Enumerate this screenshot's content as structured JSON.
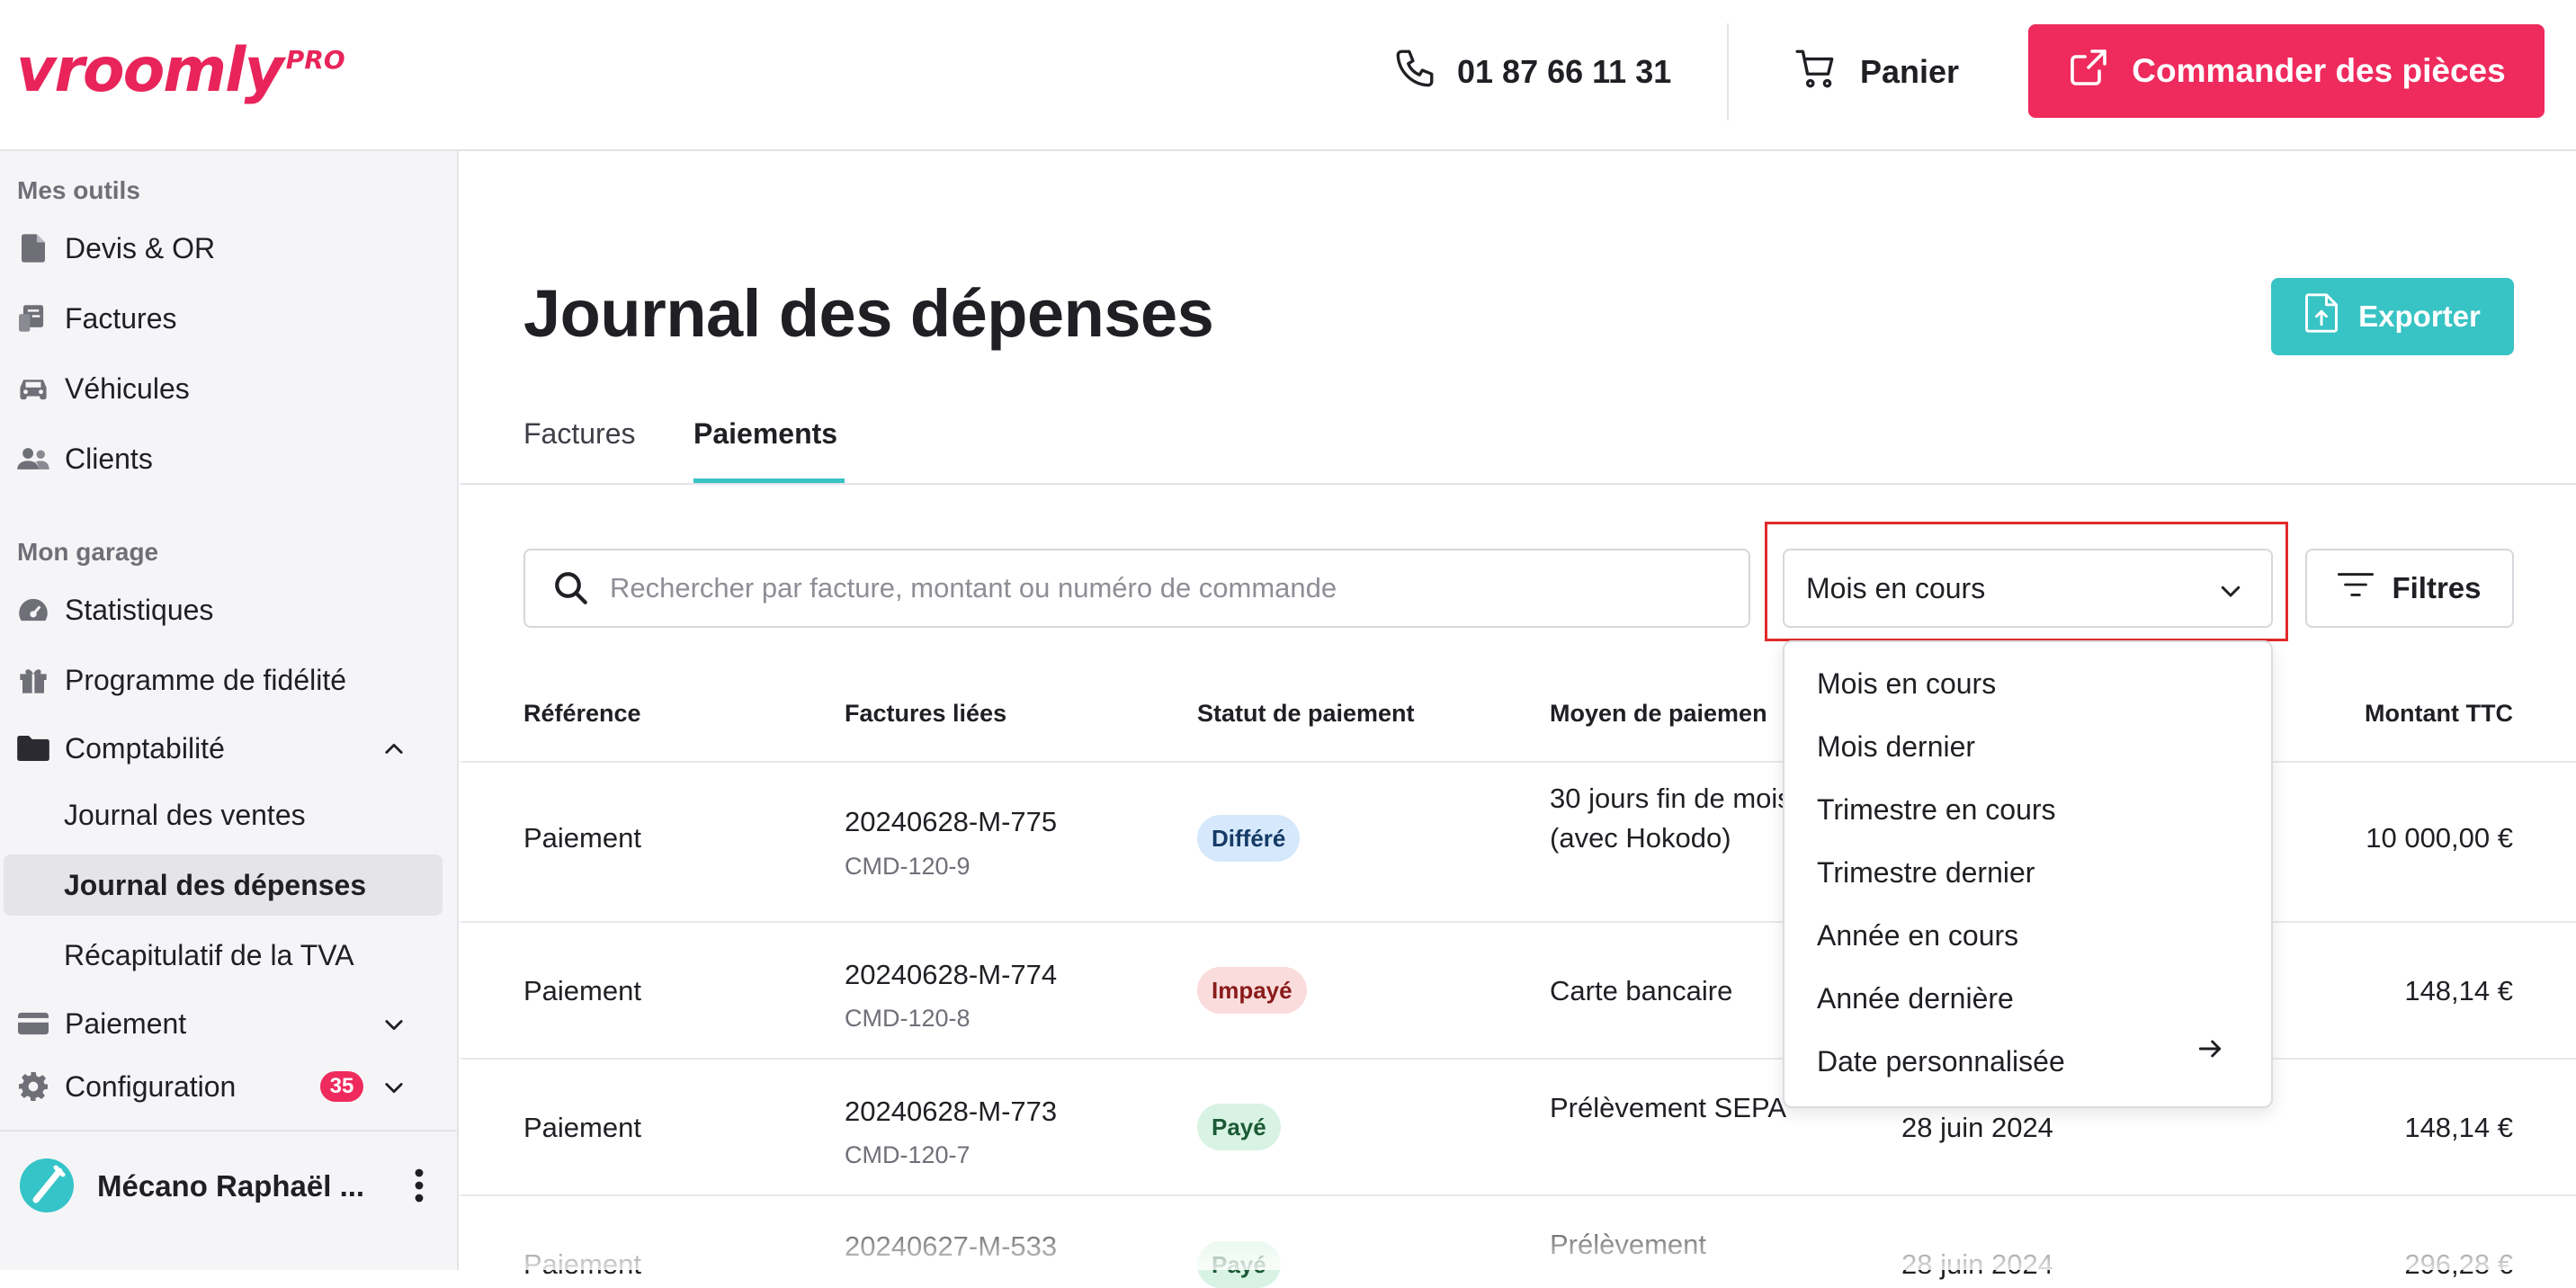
{
  "brand": {
    "logo_text": "vroomly",
    "logo_suffix": "PRO",
    "color": "#e8245a"
  },
  "header": {
    "phone": "01 87 66 11 31",
    "cart_label": "Panier",
    "order_button": "Commander des pièces"
  },
  "sidebar": {
    "section_tools": "Mes outils",
    "tools": [
      "Devis & OR",
      "Factures",
      "Véhicules",
      "Clients"
    ],
    "section_garage": "Mon garage",
    "garage": [
      "Statistiques",
      "Programme de fidélité"
    ],
    "accounting": {
      "label": "Comptabilité",
      "children": [
        "Journal des ventes",
        "Journal des dépenses",
        "Récapitulatif de la TVA"
      ],
      "active": "Journal des dépenses"
    },
    "payment": "Paiement",
    "configuration": "Configuration",
    "configuration_badge": "35",
    "user_name": "Mécano Raphaël ..."
  },
  "main": {
    "title": "Journal des dépenses",
    "export_button": "Exporter",
    "tabs": [
      "Factures",
      "Paiements"
    ],
    "active_tab": "Paiements",
    "search_placeholder": "Rechercher par facture, montant ou numéro de commande",
    "period_select": "Mois en cours",
    "filters_button": "Filtres"
  },
  "table": {
    "headers": {
      "reference": "Référence",
      "invoices": "Factures liées",
      "status": "Statut de paiement",
      "method": "Moyen de paiemen",
      "amount": "Montant TTC"
    },
    "rows": [
      {
        "reference": "Paiement",
        "invoice": "20240628-M-775",
        "order": "CMD-120-9",
        "status": "Différé",
        "method": "30 jours fin de mois (avec Hokodo)",
        "date": "",
        "amount": "10 000,00 €"
      },
      {
        "reference": "Paiement",
        "invoice": "20240628-M-774",
        "order": "CMD-120-8",
        "status": "Impayé",
        "method": "Carte bancaire",
        "date": "",
        "amount": "148,14 €"
      },
      {
        "reference": "Paiement",
        "invoice": "20240628-M-773",
        "order": "CMD-120-7",
        "status": "Payé",
        "method": "Prélèvement SEPA",
        "date": "28 juin 2024",
        "amount": "148,14 €"
      },
      {
        "reference": "Paiement",
        "invoice": "20240627-M-533",
        "order": "",
        "status": "Payé",
        "method": "Prélèvement",
        "date": "28 juin 2024",
        "amount": "296,28 €"
      }
    ]
  },
  "dropdown": {
    "options": [
      "Mois en cours",
      "Mois dernier",
      "Trimestre en cours",
      "Trimestre dernier",
      "Année en cours",
      "Année dernière",
      "Date personnalisée"
    ]
  },
  "colors": {
    "accent": "#38c3c4",
    "primary": "#ef2a5d",
    "highlight": "#e02a2a"
  }
}
